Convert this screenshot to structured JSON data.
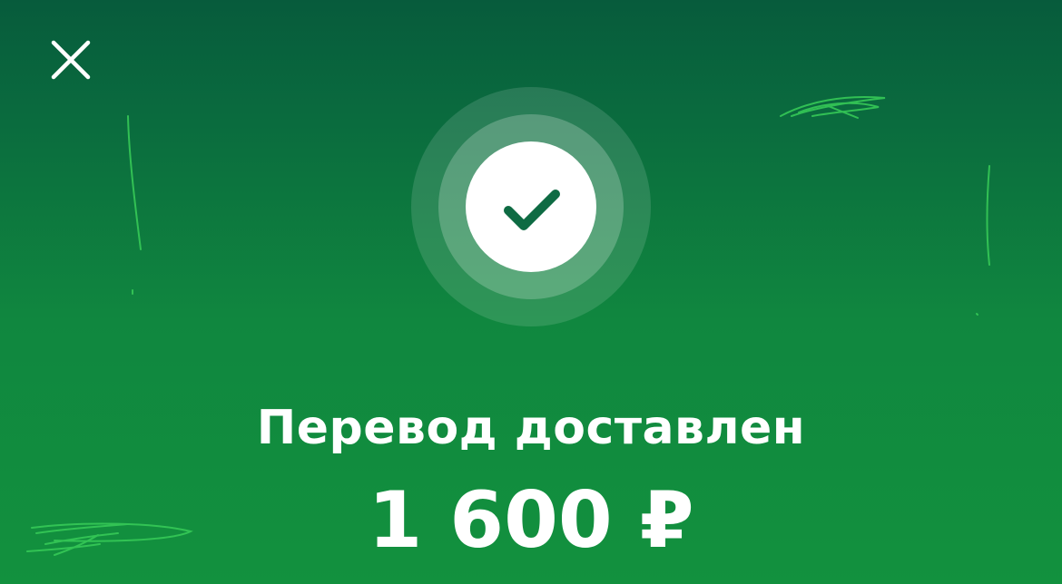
{
  "header": {
    "close_icon": "close-icon"
  },
  "status": {
    "icon": "checkmark-icon",
    "title": "Перевод доставлен",
    "amount": "1 600 ₽"
  },
  "colors": {
    "background_top": "#075b3c",
    "background_bottom": "#12913e",
    "checkmark": "#0e6b43",
    "text": "#ffffff",
    "decor_stroke": "#36c957"
  }
}
